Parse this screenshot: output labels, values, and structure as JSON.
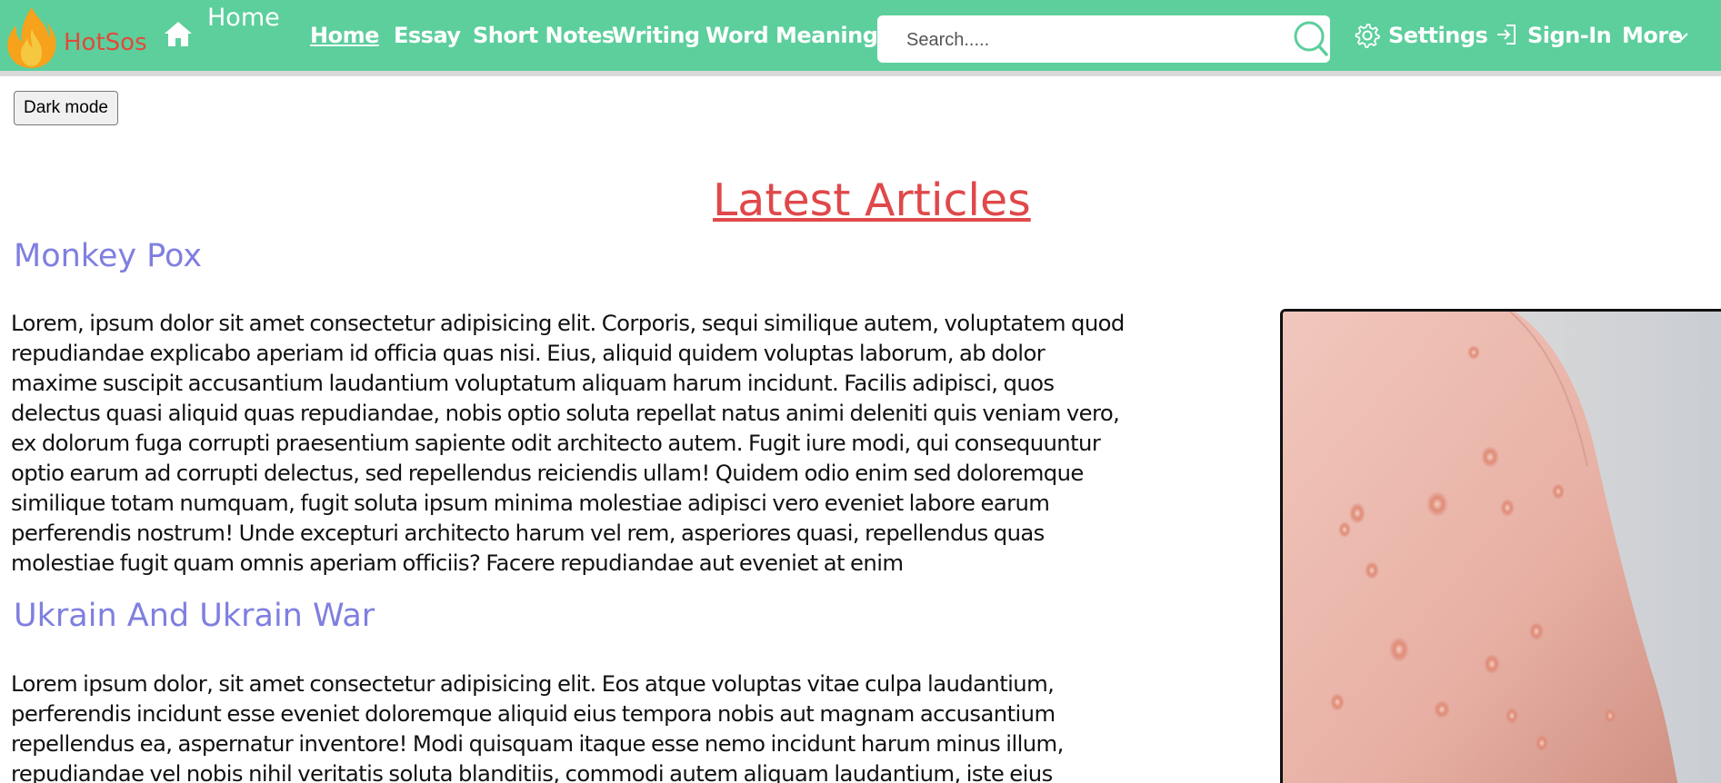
{
  "header": {
    "brand": "HotSos",
    "home_label": "Home",
    "nav": [
      {
        "label": "Home",
        "active": true
      },
      {
        "label": "Essay"
      },
      {
        "label": "Short Notes"
      },
      {
        "label": "Writing"
      },
      {
        "label": "Word Meaning"
      }
    ],
    "search_placeholder": "Search.....",
    "settings_label": "Settings",
    "signin_label": "Sign-In",
    "more_label": "More",
    "bar_color": "#5ccf9c"
  },
  "toolbar": {
    "dark_mode_label": "Dark mode"
  },
  "main": {
    "section_title": "Latest Articles",
    "articles": [
      {
        "title": "Monkey Pox",
        "lines": [
          "Lorem, ipsum dolor sit amet consectetur adipisicing elit. Corporis, sequi similique autem, voluptatem quod",
          "repudiandae explicabo aperiam id officia quas nisi. Eius, aliquid quidem voluptas laborum, ab dolor",
          "maxime suscipit accusantium laudantium voluptatum aliquam harum incidunt. Facilis adipisci, quos",
          "delectus quasi aliquid quas repudiandae, nobis optio soluta repellat natus animi deleniti quis veniam vero,",
          "ex dolorum fuga corrupti praesentium sapiente odit architecto autem. Fugit iure modi, qui consequuntur",
          "optio earum ad corrupti delectus, sed repellendus reiciendis ullam! Quidem odio enim sed doloremque",
          "similique totam numquam, fugit soluta ipsum minima molestiae adipisci vero eveniet labore earum",
          "perferendis nostrum! Unde excepturi architecto harum vel rem, asperiores quasi, repellendus quas",
          "molestiae fugit quam omnis aperiam officiis? Facere repudiandae aut eveniet at enim"
        ]
      },
      {
        "title": "Ukrain And Ukrain War",
        "lines": [
          "Lorem ipsum dolor, sit amet consectetur adipisicing elit. Eos atque voluptas vitae culpa laudantium,",
          "perferendis incidunt esse eveniet doloremque aliquid eius tempora nobis aut magnam accusantium",
          "repellendus ea, aspernatur inventore! Modi quisquam itaque esse nemo incidunt harum minus illum,",
          "repudiandae vel nobis nihil veritatis soluta blanditiis, commodi autem aliquam laudantium, iste eius"
        ]
      }
    ],
    "colors": {
      "section_title": "#e0484a",
      "article_title": "#7f7fe0"
    }
  }
}
